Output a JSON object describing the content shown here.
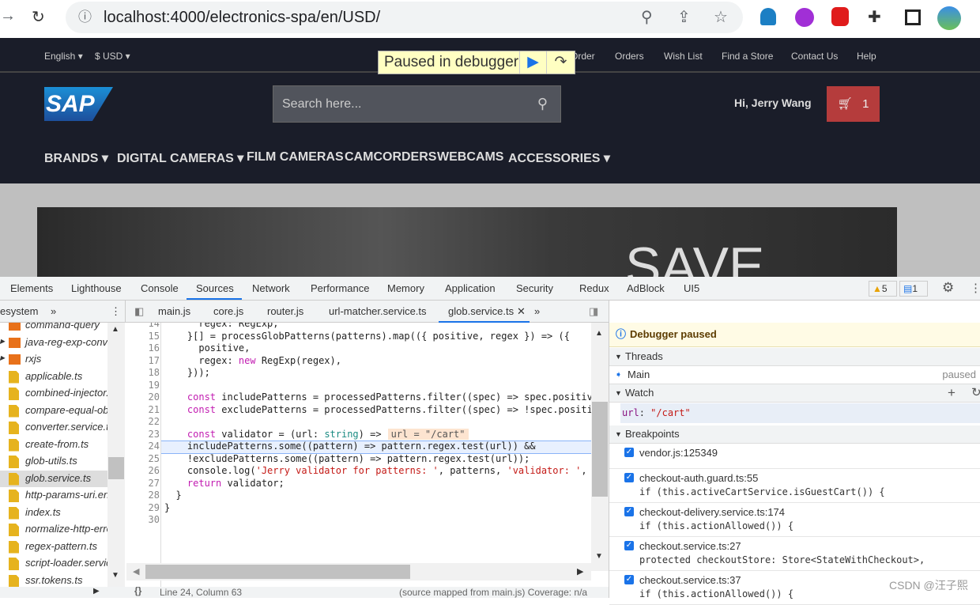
{
  "browser": {
    "url": "localhost:4000/electronics-spa/en/USD/"
  },
  "site": {
    "language": "English",
    "currency": "$ USD",
    "top_links": [
      "Order",
      "Orders",
      "Wish List",
      "Find a Store",
      "Contact Us",
      "Help"
    ],
    "logo": "SAP",
    "search_placeholder": "Search here...",
    "greeting": "Hi, Jerry Wang",
    "cart_count": "1",
    "nav": [
      "BRANDS",
      "DIGITAL CAMERAS",
      "FILM CAMERAS",
      "CAMCORDERS",
      "WEBCAMS",
      "ACCESSORIES"
    ],
    "banner_text": "SAVE"
  },
  "debugger_overlay": {
    "label": "Paused in debugger"
  },
  "devtools": {
    "tabs": [
      "Elements",
      "Lighthouse",
      "Console",
      "Sources",
      "Network",
      "Performance",
      "Memory",
      "Application",
      "Security",
      "Redux",
      "AdBlock",
      "UI5"
    ],
    "active_tab": "Sources",
    "warnings": "5",
    "messages": "1",
    "navigator_tab": "esystem",
    "file_tabs": [
      "main.js",
      "core.js",
      "router.js",
      "url-matcher.service.ts",
      "glob.service.ts"
    ],
    "active_file": "glob.service.ts",
    "tree": [
      {
        "name": "command-query",
        "type": "folder"
      },
      {
        "name": "java-reg-exp-converter",
        "type": "folder"
      },
      {
        "name": "rxjs",
        "type": "folder"
      },
      {
        "name": "applicable.ts",
        "type": "file"
      },
      {
        "name": "combined-injector.ts",
        "type": "file"
      },
      {
        "name": "compare-equal-objects.ts",
        "type": "file"
      },
      {
        "name": "converter.service.ts",
        "type": "file"
      },
      {
        "name": "create-from.ts",
        "type": "file"
      },
      {
        "name": "glob-utils.ts",
        "type": "file"
      },
      {
        "name": "glob.service.ts",
        "type": "file",
        "selected": true
      },
      {
        "name": "http-params-uri.encoder.ts",
        "type": "file"
      },
      {
        "name": "index.ts",
        "type": "file"
      },
      {
        "name": "normalize-http-error.ts",
        "type": "file"
      },
      {
        "name": "regex-pattern.ts",
        "type": "file"
      },
      {
        "name": "script-loader.service.ts",
        "type": "file"
      },
      {
        "name": "ssr.tokens.ts",
        "type": "file"
      }
    ],
    "code": [
      {
        "n": "14",
        "t": [
          [
            "",
            "      regex: RegExp;"
          ]
        ]
      },
      {
        "n": "15",
        "t": [
          [
            "",
            "    }[] = processGlobPatterns(patterns).map(({ positive, regex }) => ({"
          ]
        ]
      },
      {
        "n": "16",
        "t": [
          [
            "",
            "      positive,"
          ]
        ]
      },
      {
        "n": "17",
        "t": [
          [
            "",
            "      regex: "
          ],
          [
            "kw",
            "new"
          ],
          [
            "",
            " RegExp(regex),"
          ]
        ]
      },
      {
        "n": "18",
        "t": [
          [
            "",
            "    }));"
          ]
        ]
      },
      {
        "n": "19",
        "t": []
      },
      {
        "n": "20",
        "t": [
          [
            "",
            "    "
          ],
          [
            "kw",
            "const"
          ],
          [
            "",
            " includePatterns = processedPatterns.filter((spec) => spec.positive"
          ]
        ]
      },
      {
        "n": "21",
        "t": [
          [
            "",
            "    "
          ],
          [
            "kw",
            "const"
          ],
          [
            "",
            " excludePatterns = processedPatterns.filter((spec) => !spec.positiv"
          ]
        ]
      },
      {
        "n": "22",
        "t": []
      },
      {
        "n": "23",
        "t": [
          [
            "",
            "    "
          ],
          [
            "kw",
            "const"
          ],
          [
            "",
            " validator = (url: "
          ],
          [
            "ty",
            "string"
          ],
          [
            "",
            ") =>"
          ]
        ],
        "inline": "url = \"/cart\""
      },
      {
        "n": "24",
        "t": [
          [
            "",
            "    includePatterns.some((pattern) => pattern.regex.test(url)) &&"
          ]
        ],
        "hl": "current"
      },
      {
        "n": "25",
        "t": [
          [
            "",
            "    !excludePatterns.some((pattern) => pattern.regex.test(url));"
          ]
        ],
        "hl": "yellow"
      },
      {
        "n": "26",
        "t": [
          [
            "",
            "    console.log("
          ],
          [
            "str",
            "'Jerry validator for patterns: '"
          ],
          [
            "",
            ", patterns, "
          ],
          [
            "str",
            "'validator: '"
          ],
          [
            "",
            ", v"
          ]
        ]
      },
      {
        "n": "27",
        "t": [
          [
            "",
            "    "
          ],
          [
            "kw",
            "return"
          ],
          [
            "",
            " validator;"
          ]
        ]
      },
      {
        "n": "28",
        "t": [
          [
            "",
            "  }"
          ]
        ]
      },
      {
        "n": "29",
        "t": [
          [
            "",
            "}"
          ]
        ]
      },
      {
        "n": "30",
        "t": []
      }
    ],
    "status": {
      "position": "Line 24, Column 63",
      "source": "(source mapped from main.js) Coverage: n/a"
    },
    "paused_banner": "Debugger paused",
    "threads": {
      "title": "Threads",
      "name": "Main",
      "state": "paused"
    },
    "watch": {
      "title": "Watch",
      "key": "url",
      "value": "\"/cart\""
    },
    "breakpoints": {
      "title": "Breakpoints",
      "items": [
        {
          "loc": "vendor.js:125349",
          "code": ""
        },
        {
          "loc": "checkout-auth.guard.ts:55",
          "code": "if (this.activeCartService.isGuestCart()) {"
        },
        {
          "loc": "checkout-delivery.service.ts:174",
          "code": "if (this.actionAllowed()) {"
        },
        {
          "loc": "checkout.service.ts:27",
          "code": "protected checkoutStore: Store<StateWithCheckout>,"
        },
        {
          "loc": "checkout.service.ts:37",
          "code": "if (this.actionAllowed()) {"
        }
      ]
    }
  },
  "watermark": "CSDN @汪子熙",
  "colors": {
    "site_bg": "#1a1d29",
    "cart": "#b53c3c",
    "highlight": "#ffff00",
    "accent": "#1a73e8"
  }
}
